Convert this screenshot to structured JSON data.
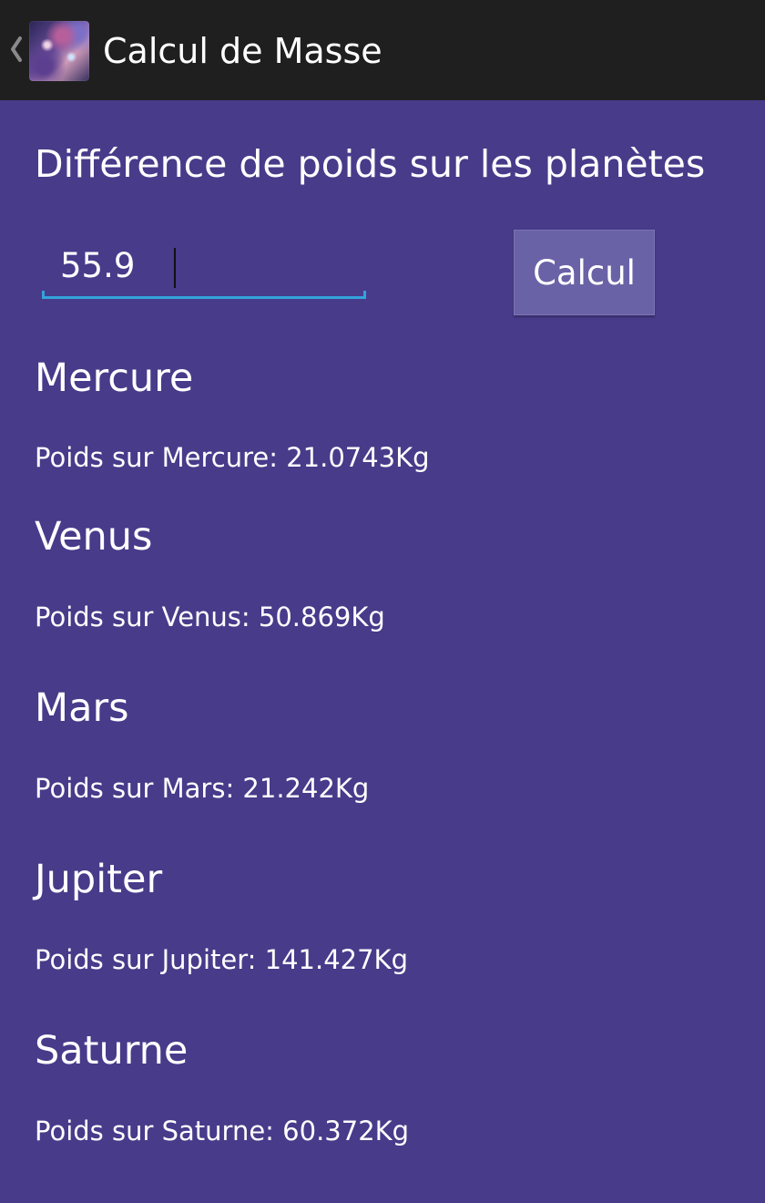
{
  "action_bar": {
    "title": "Calcul de Masse",
    "background_color": "#1f1f1f",
    "icon": "nebula-app-icon",
    "up_icon": "chevron-left-icon"
  },
  "main": {
    "background_color": "#473b8a",
    "heading": "Différence de poids sur les planètes",
    "mass_input": {
      "value": "55.9",
      "underline_color": "#33a2db"
    },
    "calc_button_label": "Calcul",
    "planets": [
      {
        "name": "Mercure",
        "weight_text": "Poids sur Mercure: 21.0743Kg"
      },
      {
        "name": "Venus",
        "weight_text": "Poids sur Venus: 50.869Kg"
      },
      {
        "name": "Mars",
        "weight_text": "Poids sur Mars: 21.242Kg"
      },
      {
        "name": "Jupiter",
        "weight_text": "Poids sur Jupiter: 141.427Kg"
      },
      {
        "name": "Saturne",
        "weight_text": "Poids sur Saturne: 60.372Kg"
      }
    ]
  }
}
